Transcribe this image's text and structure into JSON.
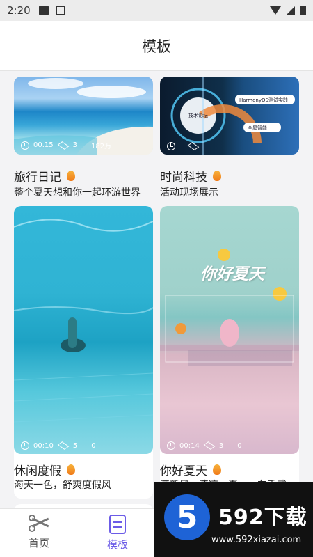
{
  "status": {
    "time": "2:20"
  },
  "header": {
    "title": "模板"
  },
  "cards": [
    {
      "title": "旅行日记",
      "subtitle": "整个夏天想和你一起环游世界",
      "duration": "00.15",
      "clips": "3",
      "uses": "182万"
    },
    {
      "title": "时尚科技",
      "subtitle": "活动现场展示",
      "duration": "",
      "clips": "",
      "uses": "",
      "overlay_1": "技术论坛",
      "overlay_2": "HarmonyOS测试实践",
      "overlay_3": "全屋智能"
    },
    {
      "title": "休闲度假",
      "subtitle": "海天一色，舒爽度假风",
      "duration": "00:10",
      "clips": "5",
      "uses": "0"
    },
    {
      "title": "你好夏天",
      "subtitle": "清新风，清凉一夏，一车乘裁",
      "duration": "00:14",
      "clips": "3",
      "uses": "0",
      "overlay_title": "你好夏天"
    }
  ],
  "tabs": [
    {
      "label": "首页"
    },
    {
      "label": "模板"
    }
  ],
  "ad": {
    "logo_text": "5",
    "brand": "592下载",
    "url": "www.592xiazai.com"
  },
  "colors": {
    "accent": "#6c5ce7",
    "flame": "#f28a1f"
  }
}
